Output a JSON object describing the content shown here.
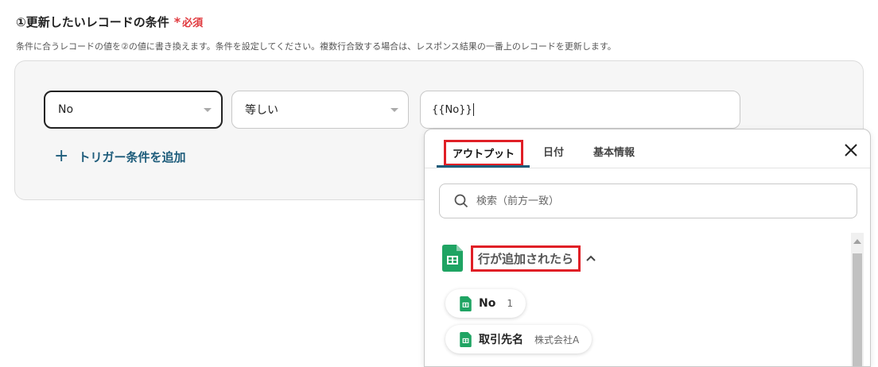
{
  "section": {
    "title": "①更新したいレコードの条件",
    "required_label": "必須",
    "description": "条件に合うレコードの値を②の値に書き換えます。条件を設定してください。複数行合致する場合は、レスポンス結果の一番上のレコードを更新します。"
  },
  "condition": {
    "key_value": "No",
    "operator_value": "等しい",
    "value_text": "{{No}}",
    "add_trigger_label": "トリガー条件を追加"
  },
  "dropdown": {
    "tabs": [
      "アウトプット",
      "日付",
      "基本情報"
    ],
    "active_tab": "アウトプット",
    "search_placeholder": "検索（前方一致）",
    "group_label": "行が追加されたら",
    "items": [
      {
        "label": "No",
        "value": "1"
      },
      {
        "label": "取引先名",
        "value": "株式会社A"
      }
    ]
  },
  "colors": {
    "accent": "#1c5b7a",
    "highlight_border": "#e01f26",
    "required": "#e0393e",
    "sheets_green": "#1fa463"
  },
  "icons": [
    "plus-icon",
    "close-icon",
    "search-icon",
    "google-sheets-icon",
    "chevron-up-icon",
    "dropdown-caret-icon"
  ]
}
